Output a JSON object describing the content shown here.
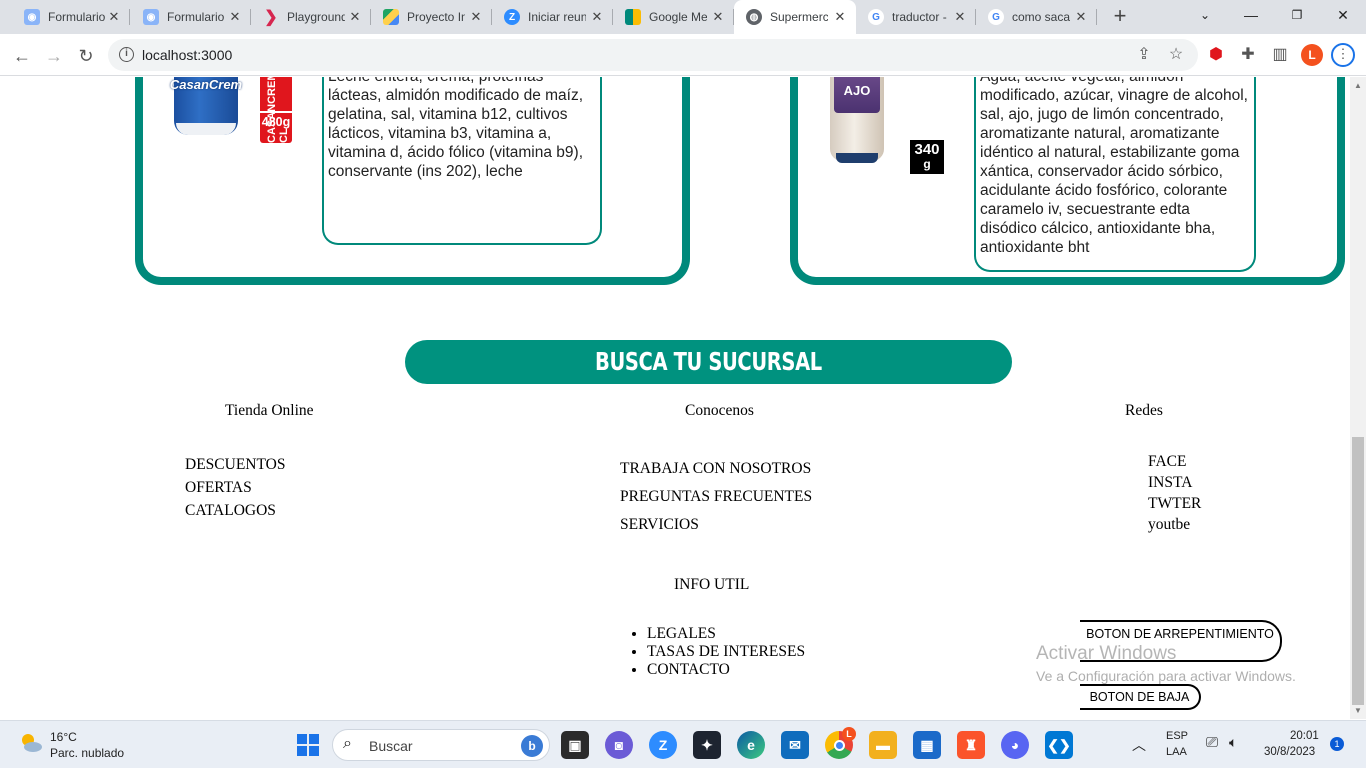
{
  "browser": {
    "tabs": [
      {
        "label": "Formulario",
        "icon": "argentina-flag-icon",
        "color": "#5b8fd6"
      },
      {
        "label": "Formulario",
        "icon": "argentina-flag-icon",
        "color": "#5b8fd6"
      },
      {
        "label": "Playground",
        "icon": "playground-arrow-icon",
        "color": "#d6264f"
      },
      {
        "label": "Proyecto In",
        "icon": "google-drive-icon",
        "color": "#1fa463"
      },
      {
        "label": "Iniciar reun",
        "icon": "zoom-icon",
        "color": "#2d8cff"
      },
      {
        "label": "Google Me",
        "icon": "google-meet-icon",
        "color": "#00897b"
      },
      {
        "label": "Supermerc",
        "icon": "globe-icon",
        "color": "#5f6368"
      },
      {
        "label": "traductor -",
        "icon": "google-icon",
        "color": "#4285f4"
      },
      {
        "label": "como saca",
        "icon": "google-icon",
        "color": "#4285f4"
      }
    ],
    "active_tab": 6,
    "url": "localhost:3000",
    "profile_initial": "L"
  },
  "products": [
    {
      "brand": "CasanCrem",
      "tag_text": "CASANCREM CL",
      "weight": "480g",
      "description": "Leche entera, crema, proteínas lácteas, almidón modificado de maíz, gelatina, sal, vitamina b12, cultivos lácticos, vitamina b3, vitamina a, vitamina d, ácido fólico (vitamina b9), conservante (ins 202), leche"
    },
    {
      "brand": "AJO",
      "weight_number": "340",
      "weight_unit": "g",
      "description": "Agua, aceite vegetal, almidón modificado, azúcar, vinagre de alcohol, sal, ajo, jugo de limón concentrado, aromatizante natural, aromatizante idéntico al natural, estabilizante goma xántica, conservador ácido sórbico, acidulante ácido fosfórico, colorante caramelo iv, secuestrante edta disódico cálcico, antioxidante bha, antioxidante bht"
    }
  ],
  "busca_title": "BUSCA TU SUCURSAL",
  "footer": {
    "tienda": {
      "title": "Tienda Online",
      "links": [
        "DESCUENTOS",
        "OFERTAS",
        "CATALOGOS"
      ]
    },
    "conocenos": {
      "title": "Conocenos",
      "links": [
        "TRABAJA CON NOSOTROS",
        "PREGUNTAS FRECUENTES",
        "SERVICIOS"
      ]
    },
    "redes": {
      "title": "Redes",
      "links": [
        "FACE",
        "INSTA",
        "TWTER",
        "youtbe"
      ]
    },
    "info": {
      "title": "INFO UTIL",
      "links": [
        "LEGALES",
        "TASAS DE INTERESES",
        "CONTACTO"
      ]
    },
    "buttons": {
      "arrepentimiento": "BOTON DE ARREPENTIMIENTO",
      "baja": "BOTON DE BAJA"
    }
  },
  "watermark": {
    "line1": "Activar Windows",
    "line2": "Ve a Configuración para activar Windows."
  },
  "taskbar": {
    "weather_temp": "16°C",
    "weather_desc": "Parc. nublado",
    "search_placeholder": "Buscar",
    "lang_top": "ESP",
    "lang_bottom": "LAA",
    "time": "20:01",
    "date": "30/8/2023",
    "notification_count": "1",
    "chrome_badge": "L"
  }
}
